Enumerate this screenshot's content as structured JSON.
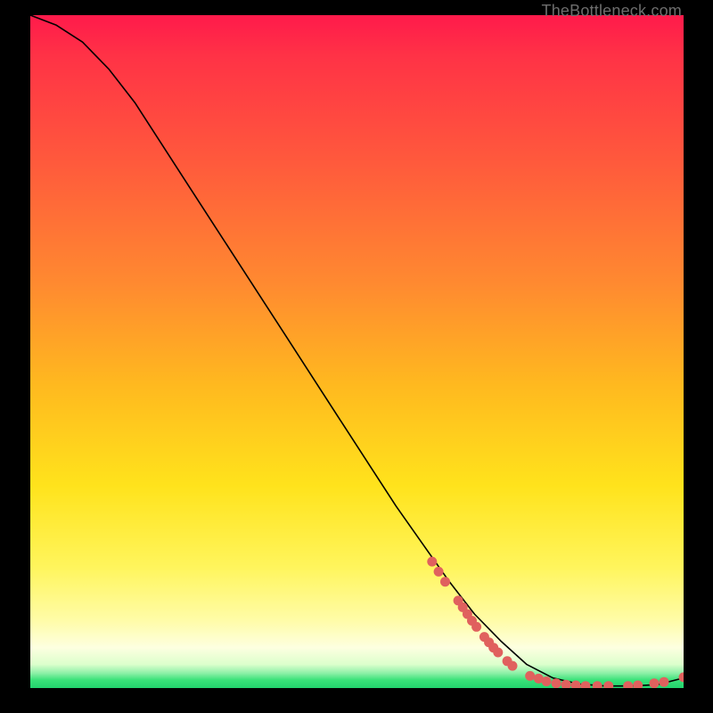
{
  "attribution": "TheBottleneck.com",
  "chart_data": {
    "type": "line",
    "title": "",
    "xlabel": "",
    "ylabel": "",
    "xlim": [
      0,
      100
    ],
    "ylim": [
      0,
      100
    ],
    "series": [
      {
        "name": "bottleneck-curve",
        "x": [
          0,
          4,
          8,
          12,
          16,
          20,
          24,
          28,
          32,
          36,
          40,
          44,
          48,
          52,
          56,
          60,
          64,
          68,
          72,
          76,
          80,
          84,
          88,
          92,
          96,
          100
        ],
        "y": [
          100,
          98.5,
          96,
          92,
          87,
          81,
          75,
          69,
          63,
          57,
          51,
          45,
          39,
          33,
          27,
          21.5,
          16,
          11,
          7,
          3.5,
          1.5,
          0.6,
          0.3,
          0.3,
          0.5,
          1.5
        ]
      }
    ],
    "markers": [
      {
        "x": 61.5,
        "y": 18.8
      },
      {
        "x": 62.5,
        "y": 17.3
      },
      {
        "x": 63.5,
        "y": 15.8
      },
      {
        "x": 65.5,
        "y": 13.0
      },
      {
        "x": 66.2,
        "y": 12.0
      },
      {
        "x": 66.9,
        "y": 11.0
      },
      {
        "x": 67.6,
        "y": 10.0
      },
      {
        "x": 68.3,
        "y": 9.1
      },
      {
        "x": 69.5,
        "y": 7.6
      },
      {
        "x": 70.2,
        "y": 6.8
      },
      {
        "x": 70.9,
        "y": 6.0
      },
      {
        "x": 71.6,
        "y": 5.3
      },
      {
        "x": 73.0,
        "y": 4.0
      },
      {
        "x": 73.8,
        "y": 3.3
      },
      {
        "x": 76.5,
        "y": 1.8
      },
      {
        "x": 77.8,
        "y": 1.4
      },
      {
        "x": 79.0,
        "y": 1.0
      },
      {
        "x": 80.5,
        "y": 0.7
      },
      {
        "x": 82.0,
        "y": 0.5
      },
      {
        "x": 83.5,
        "y": 0.4
      },
      {
        "x": 85.0,
        "y": 0.3
      },
      {
        "x": 86.8,
        "y": 0.3
      },
      {
        "x": 88.5,
        "y": 0.3
      },
      {
        "x": 91.5,
        "y": 0.3
      },
      {
        "x": 93.0,
        "y": 0.4
      },
      {
        "x": 95.5,
        "y": 0.7
      },
      {
        "x": 97.0,
        "y": 0.9
      },
      {
        "x": 100.0,
        "y": 1.6
      }
    ],
    "marker_color": "#e0615e",
    "line_color": "#000000",
    "background": "red-yellow-green gradient"
  }
}
